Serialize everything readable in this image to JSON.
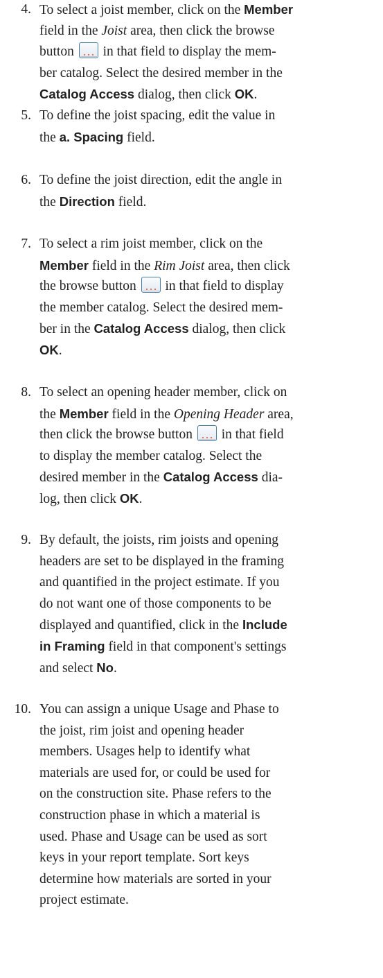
{
  "steps": [
    {
      "number": "4.",
      "lines": [
        [
          {
            "t": "To select a joist member, click on the "
          },
          {
            "t": "Member",
            "s": "ui"
          }
        ],
        [
          {
            "t": "field in the "
          },
          {
            "t": "Joist",
            "s": "ital"
          },
          {
            "t": " area, then click the browse"
          }
        ],
        [
          {
            "t": "button "
          },
          {
            "icon": "browse-button-icon"
          },
          {
            "t": " in that field to display the mem-"
          }
        ],
        [
          {
            "t": "ber catalog. Select the desired member in the"
          }
        ],
        [
          {
            "t": "Catalog Access",
            "s": "ui"
          },
          {
            "t": " dialog, then click "
          },
          {
            "t": "OK",
            "s": "ui"
          },
          {
            "t": "."
          }
        ]
      ]
    },
    {
      "number": "5.",
      "lines": [
        [
          {
            "t": "To define the joist spacing, edit the value in"
          }
        ],
        [
          {
            "t": "the "
          },
          {
            "t": "a. Spacing",
            "s": "ui"
          },
          {
            "t": " field."
          }
        ]
      ]
    },
    {
      "number": "6.",
      "lines": [
        [
          {
            "t": "To define the joist direction, edit the angle in"
          }
        ],
        [
          {
            "t": "the "
          },
          {
            "t": "Direction",
            "s": "ui"
          },
          {
            "t": " field."
          }
        ]
      ]
    },
    {
      "number": "7.",
      "lines": [
        [
          {
            "t": "To select a rim joist member, click on the"
          }
        ],
        [
          {
            "t": "Member",
            "s": "ui"
          },
          {
            "t": " field in the "
          },
          {
            "t": "Rim Joist",
            "s": "ital"
          },
          {
            "t": " area, then click"
          }
        ],
        [
          {
            "t": "the browse button "
          },
          {
            "icon": "browse-button-icon"
          },
          {
            "t": " in that field to display"
          }
        ],
        [
          {
            "t": "the member catalog. Select the desired mem-"
          }
        ],
        [
          {
            "t": "ber in the "
          },
          {
            "t": "Catalog Access",
            "s": "ui"
          },
          {
            "t": " dialog, then click"
          }
        ],
        [
          {
            "t": "OK",
            "s": "ui"
          },
          {
            "t": "."
          }
        ]
      ]
    },
    {
      "number": "8.",
      "lines": [
        [
          {
            "t": "To select an opening header member, click on"
          }
        ],
        [
          {
            "t": "the "
          },
          {
            "t": "Member",
            "s": "ui"
          },
          {
            "t": " field in the "
          },
          {
            "t": "Opening Header",
            "s": "ital"
          },
          {
            "t": " area,"
          }
        ],
        [
          {
            "t": "then click the browse button "
          },
          {
            "icon": "browse-button-icon"
          },
          {
            "t": " in that field"
          }
        ],
        [
          {
            "t": "to display the member catalog. Select the"
          }
        ],
        [
          {
            "t": "desired member in the "
          },
          {
            "t": "Catalog Access",
            "s": "ui"
          },
          {
            "t": " dia-"
          }
        ],
        [
          {
            "t": "log, then click "
          },
          {
            "t": "OK",
            "s": "ui"
          },
          {
            "t": "."
          }
        ]
      ]
    },
    {
      "number": "9.",
      "lines": [
        [
          {
            "t": "By default, the joists, rim joists and opening"
          }
        ],
        [
          {
            "t": "headers are set to be displayed in the framing"
          }
        ],
        [
          {
            "t": "and quantified in the project estimate. If you"
          }
        ],
        [
          {
            "t": "do not want one of those components to be"
          }
        ],
        [
          {
            "t": "displayed and quantified, click in the "
          },
          {
            "t": "Include",
            "s": "ui"
          }
        ],
        [
          {
            "t": "in Framing",
            "s": "ui"
          },
          {
            "t": " field in that component's settings"
          }
        ],
        [
          {
            "t": "and select "
          },
          {
            "t": "No",
            "s": "ui"
          },
          {
            "t": "."
          }
        ]
      ]
    },
    {
      "number": "10.",
      "lines": [
        [
          {
            "t": "You can assign a unique Usage and Phase to"
          }
        ],
        [
          {
            "t": "the joist, rim joist and opening header"
          }
        ],
        [
          {
            "t": "members. Usages help to identify what"
          }
        ],
        [
          {
            "t": "materials are used for, or could be used for"
          }
        ],
        [
          {
            "t": "on the construction site. Phase refers to the"
          }
        ],
        [
          {
            "t": "construction phase in which a material is"
          }
        ],
        [
          {
            "t": "used. Phase and Usage can be used as sort"
          }
        ],
        [
          {
            "t": "keys in your report template. Sort keys"
          }
        ],
        [
          {
            "t": "determine how materials are sorted in your"
          }
        ],
        [
          {
            "t": "project estimate."
          }
        ]
      ]
    }
  ]
}
